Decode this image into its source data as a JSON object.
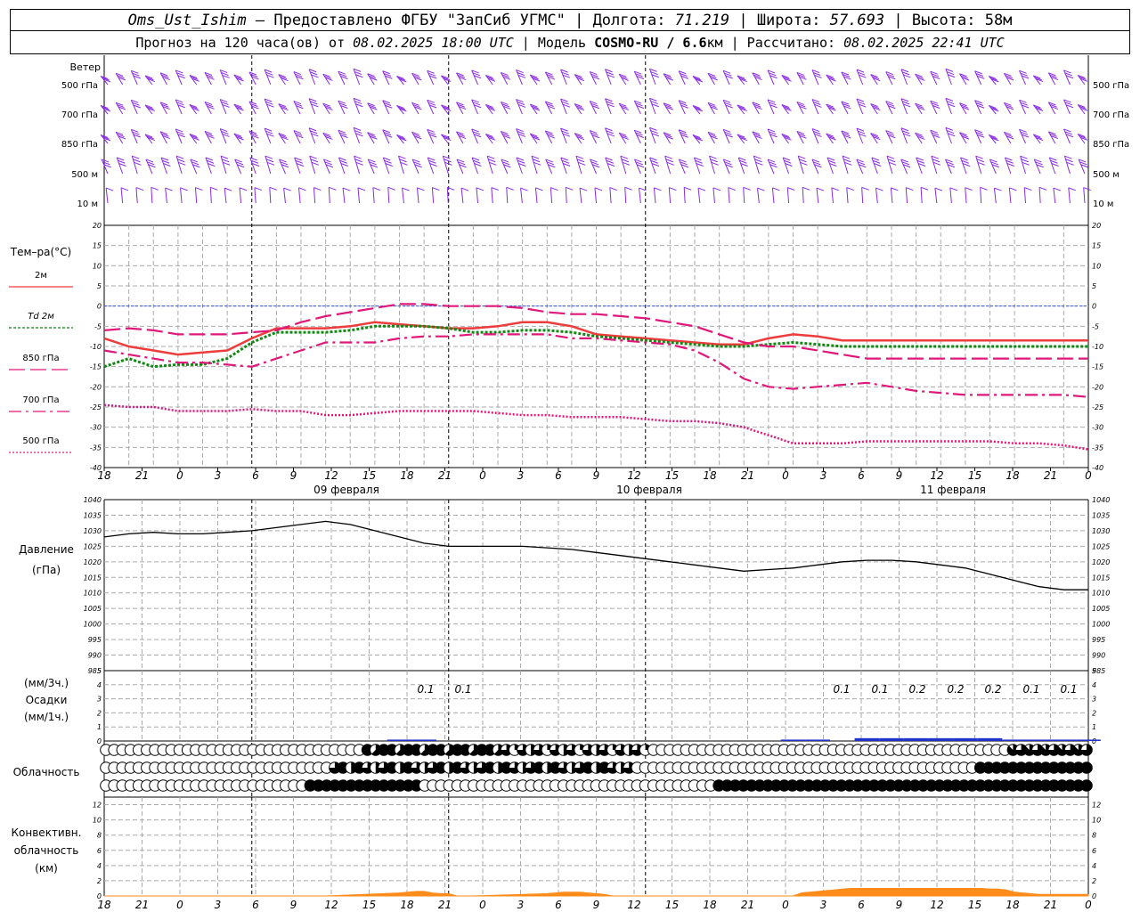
{
  "header": {
    "station": "Oms_Ust_Ishim",
    "provider": " – Предоставлено ФГБУ \"ЗапСиб УГМС\" | Долгота: ",
    "lon": "71.219",
    "lat_label": " | Широта: ",
    "lat": "57.693",
    "alt_label": " | Высота: 58м",
    "forecast_prefix": "Прогноз на 120 часа(ов) от ",
    "start": "08.02.2025 18:00 UTC",
    "model_label": " | Модель ",
    "model": "COSMO-RU / 6.6",
    "model_unit": "км | Рассчитано: ",
    "computed": "08.02.2025 22:41 UTC"
  },
  "time_axis": {
    "hour_labels": [
      "18",
      "21",
      "0",
      "3",
      "6",
      "9",
      "12",
      "15",
      "18",
      "21",
      "0",
      "3",
      "6",
      "9",
      "12",
      "15",
      "18",
      "21",
      "0",
      "3",
      "6",
      "9",
      "12",
      "15",
      "18",
      "21",
      "0"
    ],
    "date_labels": [
      "09 февраля",
      "10 февраля",
      "11 февраля"
    ]
  },
  "wind_panel": {
    "title": "Ветер",
    "levels": [
      "500 гПа",
      "700 гПа",
      "850 гПа",
      "500 м",
      "10 м"
    ],
    "levels_right": [
      "500 гПа",
      "700 гПа",
      "850 гПа",
      "500 м",
      "10 м"
    ],
    "barb_color": "#8a2be2"
  },
  "colors": {
    "t2m": "#ee3b3b",
    "td2m": "#118811",
    "t850": "#e0177a",
    "t700": "#e0177a",
    "t500": "#e0177a",
    "pressure": "#000000",
    "precip": "#2233cc",
    "convective": "#ff8c1a",
    "zero_line": "#3355dd"
  },
  "temp_panel": {
    "title": "Тем–ра(°C)",
    "legend": [
      "2м",
      "Td  2м",
      "850 гПа",
      "700 гПа",
      "500 гПа"
    ]
  },
  "pressure_panel": {
    "title_line1": "Давление",
    "title_line2": "(гПа)"
  },
  "precip_panel": {
    "title_line1": "(мм/3ч.)",
    "title_line2": "Осадки",
    "title_line3": "(мм/1ч.)",
    "labels_left": [
      "0.1",
      "0.1"
    ],
    "labels_right": [
      "0.1",
      "0.1",
      "0.2",
      "0.2",
      "0.2",
      "0.1",
      "0.1"
    ]
  },
  "cloud_panel": {
    "title": "Облачность"
  },
  "convective_panel": {
    "title_line1": "Конвективн.",
    "title_line2": "облачность",
    "title_line3": "(км)"
  },
  "chart_data": [
    {
      "type": "line",
      "title": "Тем–ра(°C)",
      "x_hours": [
        0,
        3,
        6,
        9,
        12,
        15,
        18,
        21,
        24,
        27,
        30,
        33,
        36,
        39,
        42,
        45,
        48,
        51,
        54,
        57,
        60,
        63,
        66,
        69,
        72,
        75,
        78,
        81,
        84,
        87,
        90,
        93,
        96,
        99,
        102,
        105,
        108,
        111,
        114,
        117,
        120
      ],
      "ylim": [
        -40,
        20
      ],
      "series": [
        {
          "name": "2м",
          "values": [
            -8,
            -10,
            -11,
            -12,
            -11.5,
            -11,
            -8,
            -5.5,
            -5.5,
            -5.5,
            -5,
            -4,
            -4.5,
            -5,
            -5.5,
            -5.5,
            -5,
            -4,
            -4,
            -5,
            -7,
            -7.5,
            -8,
            -8.5,
            -9,
            -9.5,
            -9.5,
            -8,
            -7,
            -7.5,
            -8.5,
            -8.5,
            -8.5,
            -8.5,
            -8.5,
            -8.5,
            -8.5,
            -8.5,
            -8.5,
            -8.5,
            -8.5
          ]
        },
        {
          "name": "Td  2м",
          "values": [
            -15,
            -13,
            -15,
            -14.5,
            -14.5,
            -13,
            -9,
            -6.5,
            -6.5,
            -6.5,
            -6,
            -5,
            -5,
            -5,
            -5.5,
            -6.5,
            -6.5,
            -6,
            -6,
            -6.5,
            -7.5,
            -8,
            -8.5,
            -9,
            -9.5,
            -10,
            -10,
            -9.5,
            -9,
            -9.5,
            -10,
            -10,
            -10,
            -10,
            -10,
            -10,
            -10,
            -10,
            -10,
            -10,
            -10
          ]
        },
        {
          "name": "850 гПа",
          "values": [
            -6,
            -5.5,
            -6,
            -7,
            -7,
            -7,
            -6.5,
            -6,
            -4,
            -2.5,
            -1.5,
            -0.5,
            0.5,
            0.5,
            0,
            0,
            0,
            -0.5,
            -1.5,
            -2,
            -2,
            -2.5,
            -3,
            -4,
            -5,
            -7,
            -9,
            -10,
            -10,
            -11,
            -12,
            -13,
            -13,
            -13,
            -13,
            -13,
            -13,
            -13,
            -13,
            -13,
            -13
          ]
        },
        {
          "name": "700 гПа",
          "values": [
            -11,
            -12,
            -13,
            -14,
            -14,
            -14.5,
            -15,
            -13,
            -11,
            -9,
            -9,
            -9,
            -8,
            -7.5,
            -7.5,
            -7,
            -7,
            -7,
            -7,
            -8,
            -8,
            -8.5,
            -9,
            -9.5,
            -11,
            -14,
            -18,
            -20,
            -20.5,
            -20,
            -19.5,
            -19,
            -20,
            -21,
            -21.5,
            -22,
            -22,
            -22,
            -22,
            -22,
            -22.5
          ]
        },
        {
          "name": "500 гПа",
          "values": [
            -24.5,
            -25,
            -25,
            -26,
            -26,
            -26,
            -25.5,
            -26,
            -26,
            -27,
            -27,
            -26.5,
            -26,
            -26,
            -26,
            -26,
            -26.5,
            -27,
            -27,
            -27.5,
            -27.5,
            -27.5,
            -28,
            -28.5,
            -28.5,
            -29,
            -30,
            -32,
            -34,
            -34,
            -34,
            -33.5,
            -33.5,
            -33.5,
            -33.5,
            -33.5,
            -33.5,
            -34,
            -34,
            -34.5,
            -35.5
          ]
        }
      ]
    },
    {
      "type": "line",
      "title": "Давление (гПа)",
      "x_hours": [
        0,
        3,
        6,
        9,
        12,
        15,
        18,
        21,
        24,
        27,
        30,
        33,
        36,
        39,
        42,
        45,
        48,
        51,
        54,
        57,
        60,
        63,
        66,
        69,
        72,
        75,
        78,
        81,
        84,
        87,
        90,
        93,
        96,
        99,
        102,
        105,
        108,
        111,
        114,
        117,
        120
      ],
      "ylim": [
        985,
        1040
      ],
      "series": [
        {
          "name": "Давление",
          "values": [
            1028,
            1029,
            1029.5,
            1029,
            1029,
            1029.5,
            1030,
            1031,
            1032,
            1033,
            1032,
            1030,
            1028,
            1026,
            1025,
            1025,
            1025,
            1025,
            1024.5,
            1024,
            1023,
            1022,
            1021,
            1020,
            1019,
            1018,
            1017,
            1017.5,
            1018,
            1019,
            1020,
            1020.5,
            1020.5,
            1020,
            1019,
            1018,
            1016,
            1014,
            1012,
            1011,
            1011
          ]
        }
      ]
    },
    {
      "type": "bar",
      "title": "Осадки",
      "x_hours": [
        36,
        39,
        84,
        87,
        93,
        96,
        99,
        102,
        105,
        108,
        111,
        114,
        117,
        120
      ],
      "values": [
        0.1,
        0.1,
        0.1,
        0.1,
        0.2,
        0.2,
        0.2,
        0.2,
        0.2,
        0.2,
        0.1,
        0.1,
        0.1,
        0.1
      ],
      "ylim": [
        0,
        5
      ]
    },
    {
      "type": "table",
      "title": "Облачность",
      "rows": [
        [
          0,
          0,
          0,
          0,
          0,
          0,
          0,
          0,
          0,
          0,
          0,
          0,
          0,
          0,
          0,
          0,
          0,
          0,
          0,
          0,
          0,
          0,
          0,
          0,
          0,
          0,
          0,
          0,
          0,
          0,
          0,
          0,
          0,
          0,
          0,
          0,
          0,
          0,
          0,
          0,
          0,
          0,
          0,
          0,
          0,
          0,
          0,
          0,
          0,
          0,
          0,
          0,
          0,
          0,
          0,
          0,
          0,
          0,
          0,
          0,
          0,
          0,
          0,
          0,
          0,
          0,
          0,
          0,
          0,
          0,
          0,
          0,
          0,
          0,
          0,
          0,
          0,
          0,
          0,
          0,
          0,
          0,
          0,
          0,
          0,
          0,
          0,
          0,
          0,
          0,
          0,
          0,
          0,
          0,
          0,
          0,
          0,
          0,
          0,
          0,
          0,
          0,
          0,
          0,
          0,
          0,
          0,
          0,
          0,
          0,
          0,
          0,
          0,
          0,
          0,
          0,
          0,
          0,
          0,
          0,
          0,
          0
        ],
        [
          0,
          0,
          0,
          0,
          0,
          0,
          0,
          0,
          0,
          0,
          0,
          0,
          0,
          0,
          0,
          0,
          0,
          0,
          0,
          0,
          0,
          0,
          0,
          0,
          0,
          0,
          0,
          0,
          0,
          0,
          0,
          0,
          0,
          0,
          0,
          0,
          0,
          0,
          0,
          0,
          0,
          0,
          0,
          0,
          0,
          0,
          0,
          0,
          0,
          0,
          0,
          0,
          0,
          0,
          0,
          0,
          0,
          0,
          0,
          0,
          0,
          0,
          0,
          0,
          0,
          0,
          0,
          0,
          0,
          0,
          0,
          0,
          0,
          0,
          0,
          0,
          0,
          0,
          0,
          0,
          0,
          0,
          0,
          0,
          0,
          0,
          0,
          0,
          0,
          0,
          0,
          0,
          0,
          0,
          0,
          0,
          0,
          0,
          0,
          0,
          0,
          0,
          0,
          0,
          0,
          0,
          0,
          0,
          0,
          0,
          0,
          0,
          0,
          0,
          0,
          0,
          0,
          0,
          0,
          0,
          0,
          0
        ],
        [
          0,
          0,
          0,
          0,
          0,
          0,
          0,
          0,
          0,
          0,
          0,
          0,
          0,
          0,
          0,
          0,
          0,
          0,
          0,
          0,
          0,
          0,
          0,
          0,
          0,
          0,
          0,
          0,
          0,
          0,
          0,
          0,
          0,
          0,
          0,
          0,
          0,
          0,
          0,
          0,
          0,
          0,
          0,
          0,
          0,
          0,
          0,
          0,
          0,
          0,
          0,
          0,
          0,
          0,
          0,
          0,
          0,
          0,
          0,
          0,
          0,
          0,
          0,
          0,
          0,
          0,
          0,
          0,
          0,
          0,
          0,
          0,
          0,
          0,
          0,
          0,
          0,
          0,
          0,
          0,
          0,
          0,
          0,
          0,
          0,
          0,
          0,
          0,
          0,
          0,
          0,
          0,
          0,
          0,
          0,
          0,
          0,
          0,
          0,
          0,
          0,
          0,
          0,
          0,
          0,
          0,
          0,
          0,
          0,
          0,
          0,
          0,
          0,
          0,
          0,
          0,
          0,
          0,
          0,
          0,
          0,
          0
        ]
      ]
    },
    {
      "type": "area",
      "title": "Конвективн. облачность (км)",
      "x_hours": [
        0,
        18,
        19,
        20,
        21,
        22,
        23,
        24,
        25,
        26,
        27,
        36,
        37,
        38,
        39,
        40,
        41,
        42,
        43,
        44,
        45,
        54,
        55,
        56,
        57,
        58,
        59,
        60,
        61,
        62,
        63,
        84,
        85,
        86,
        87,
        88,
        89,
        90,
        91,
        92,
        93,
        94,
        95,
        96,
        97,
        98,
        99,
        100,
        101,
        102,
        103,
        104,
        105,
        106,
        107,
        108,
        109,
        110,
        111,
        112,
        113,
        114,
        115,
        116,
        117,
        118,
        119,
        120
      ],
      "values": [
        0,
        0,
        0,
        0,
        0,
        0,
        0,
        0,
        0,
        0,
        0,
        0.4,
        0.5,
        0.6,
        0.6,
        0.4,
        0.3,
        0.3,
        0,
        0,
        0,
        0.3,
        0.4,
        0.5,
        0.5,
        0.5,
        0.4,
        0.3,
        0.2,
        0,
        0,
        0,
        0.4,
        0.5,
        0.6,
        0.7,
        0.8,
        0.9,
        1.0,
        1.0,
        1.0,
        1.0,
        1.0,
        1.0,
        1.0,
        1.0,
        1.0,
        1.0,
        1.0,
        1.0,
        1.0,
        1.0,
        1.0,
        1.0,
        1.0,
        0.9,
        0.9,
        0.8,
        0.5,
        0.4,
        0.3,
        0.2,
        0.2,
        0.2,
        0.2,
        0.2,
        0.2,
        0.2
      ],
      "ylim": [
        0,
        13
      ]
    }
  ]
}
